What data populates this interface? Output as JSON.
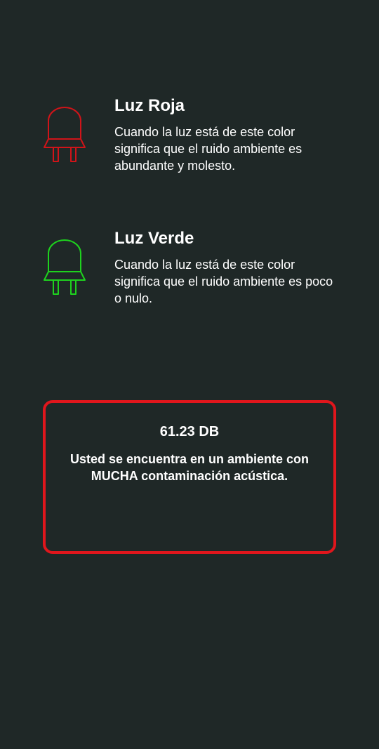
{
  "lights": {
    "red": {
      "title": "Luz Roja",
      "description": "Cuando la luz está de este color significa que el ruido ambiente es abundante y molesto.",
      "color": "#d01419",
      "icon": "led-icon"
    },
    "green": {
      "title": "Luz Verde",
      "description": "Cuando la luz está de este color significa que el ruido ambiente es poco o nulo.",
      "color": "#1ed21e",
      "icon": "led-icon"
    }
  },
  "status": {
    "decibels": "61.23 DB",
    "message": "Usted se encuentra en un ambiente con MUCHA contaminación acústica.",
    "border_color": "#e0161c"
  },
  "theme": {
    "background": "#1f2827",
    "text": "#ffffff"
  }
}
